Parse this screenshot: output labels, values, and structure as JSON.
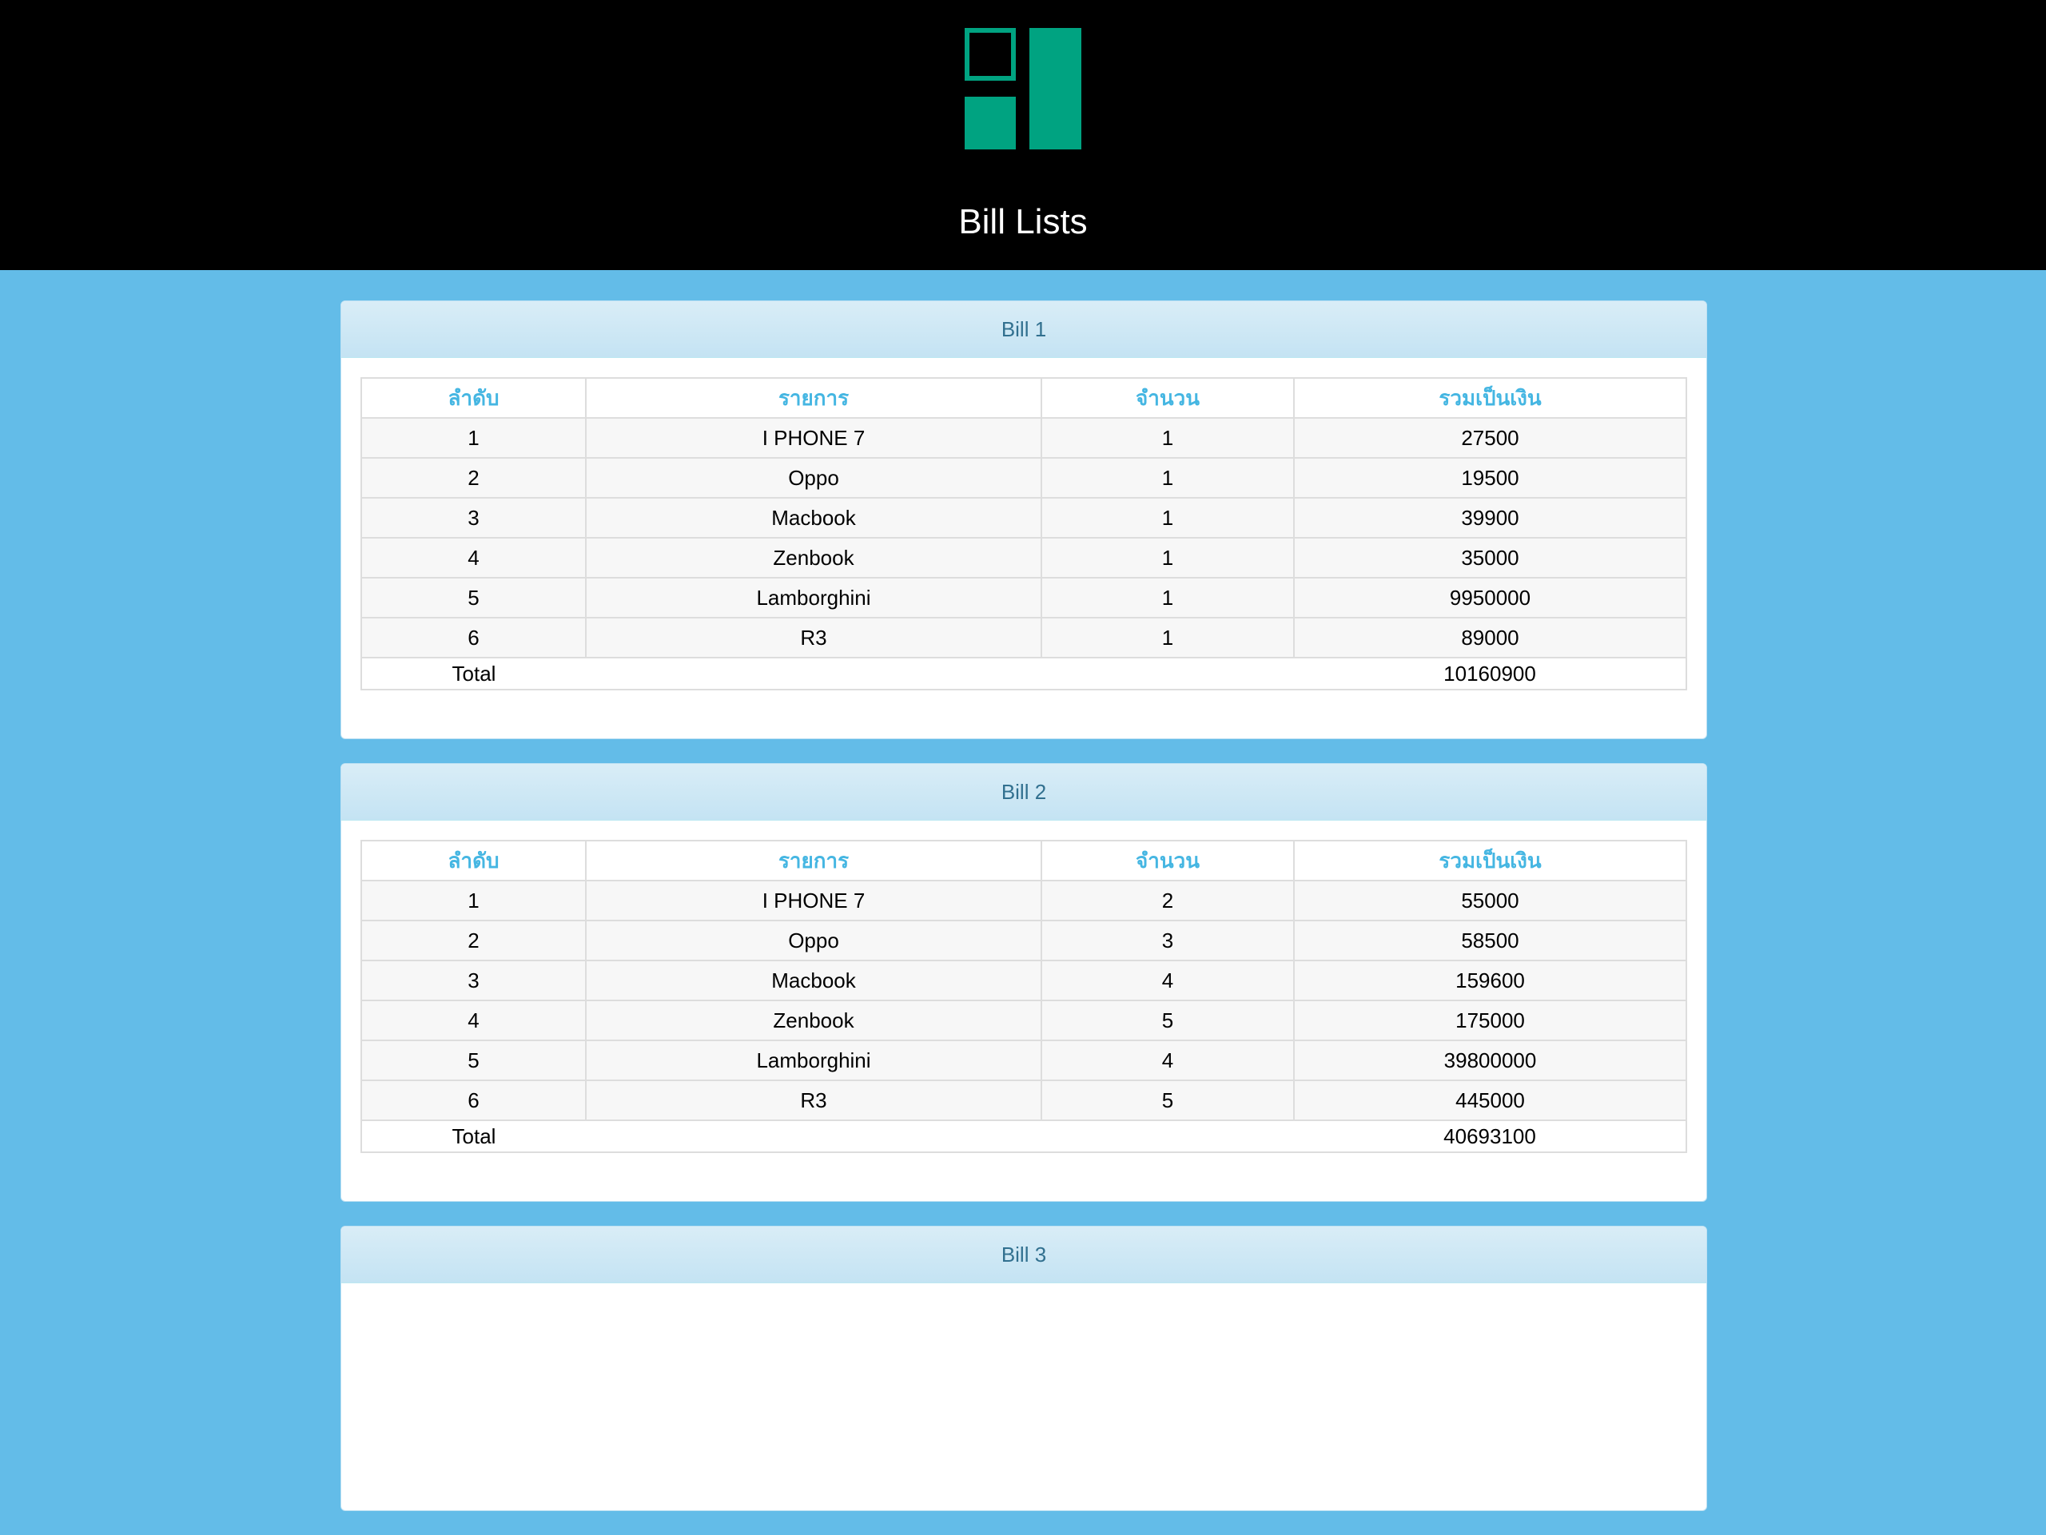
{
  "header": {
    "title": "Bill Lists",
    "logo_color": "#00a381"
  },
  "table_headers": {
    "col1": "ลำดับ",
    "col2": "รายการ",
    "col3": "จำนวน",
    "col4": "รวมเป็นเงิน"
  },
  "bills": [
    {
      "title": "Bill 1",
      "rows": [
        {
          "no": "1",
          "item": "I PHONE 7",
          "qty": "1",
          "amount": "27500"
        },
        {
          "no": "2",
          "item": "Oppo",
          "qty": "1",
          "amount": "19500"
        },
        {
          "no": "3",
          "item": "Macbook",
          "qty": "1",
          "amount": "39900"
        },
        {
          "no": "4",
          "item": "Zenbook",
          "qty": "1",
          "amount": "35000"
        },
        {
          "no": "5",
          "item": "Lamborghini",
          "qty": "1",
          "amount": "9950000"
        },
        {
          "no": "6",
          "item": "R3",
          "qty": "1",
          "amount": "89000"
        }
      ],
      "total_label": "Total",
      "total_value": "10160900"
    },
    {
      "title": "Bill 2",
      "rows": [
        {
          "no": "1",
          "item": "I PHONE 7",
          "qty": "2",
          "amount": "55000"
        },
        {
          "no": "2",
          "item": "Oppo",
          "qty": "3",
          "amount": "58500"
        },
        {
          "no": "3",
          "item": "Macbook",
          "qty": "4",
          "amount": "159600"
        },
        {
          "no": "4",
          "item": "Zenbook",
          "qty": "5",
          "amount": "175000"
        },
        {
          "no": "5",
          "item": "Lamborghini",
          "qty": "4",
          "amount": "39800000"
        },
        {
          "no": "6",
          "item": "R3",
          "qty": "5",
          "amount": "445000"
        }
      ],
      "total_label": "Total",
      "total_value": "40693100"
    },
    {
      "title": "Bill 3"
    }
  ]
}
